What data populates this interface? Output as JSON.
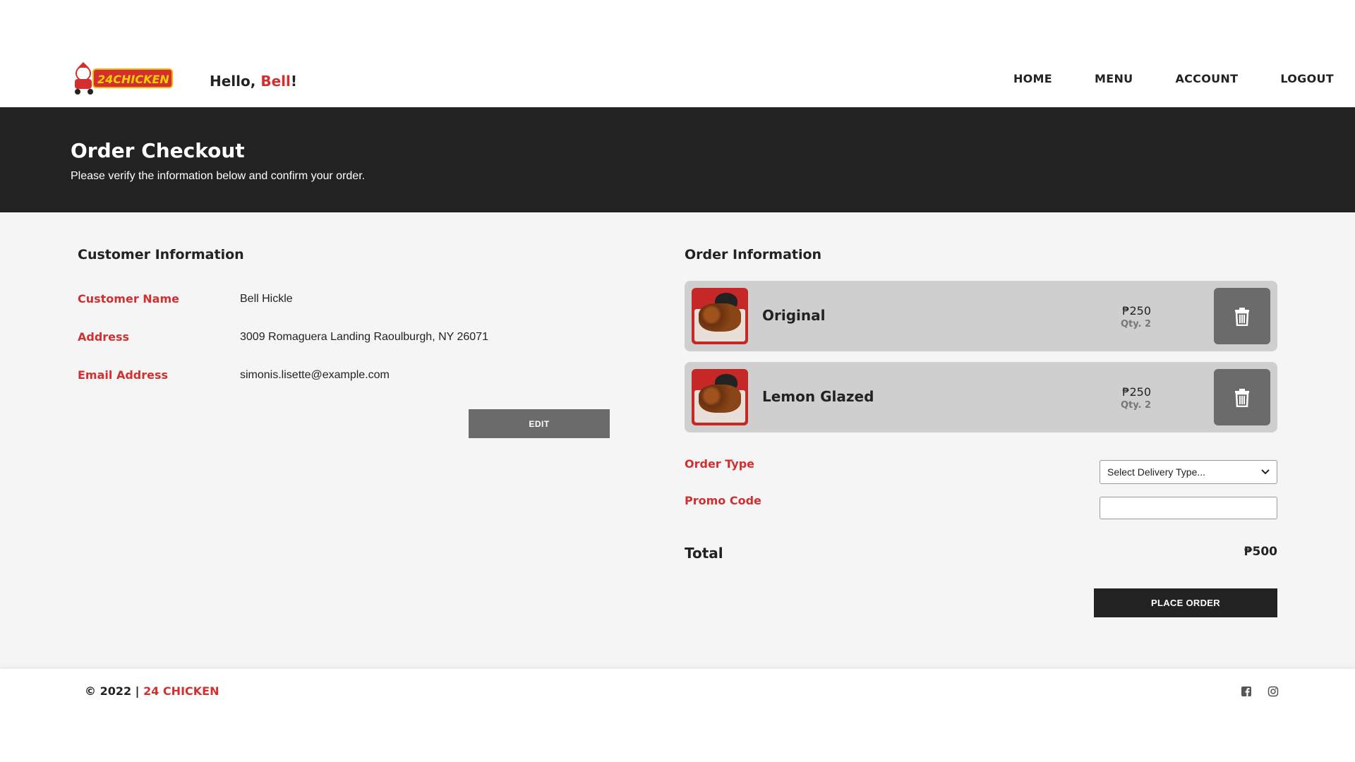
{
  "header": {
    "logo_text": "24CHICKEN",
    "greeting_prefix": "Hello, ",
    "greeting_name": "Bell",
    "greeting_suffix": "!",
    "nav": [
      "HOME",
      "MENU",
      "ACCOUNT",
      "LOGOUT"
    ]
  },
  "banner": {
    "title": "Order Checkout",
    "subtitle": "Please verify the information below and confirm your order."
  },
  "customer": {
    "title": "Customer Information",
    "rows": [
      {
        "label": "Customer Name",
        "value": "Bell Hickle"
      },
      {
        "label": "Address",
        "value": "3009 Romaguera Landing Raoulburgh, NY 26071"
      },
      {
        "label": "Email Address",
        "value": "simonis.lisette@example.com"
      }
    ],
    "edit_label": "EDIT"
  },
  "order": {
    "title": "Order Information",
    "items": [
      {
        "name": "Original",
        "price": "₱250",
        "qty": "Qty. 2"
      },
      {
        "name": "Lemon Glazed",
        "price": "₱250",
        "qty": "Qty. 2"
      }
    ],
    "order_type_label": "Order Type",
    "order_type_value": "Select Delivery Type...",
    "promo_label": "Promo Code",
    "promo_value": "",
    "total_label": "Total",
    "total_value": "₱500",
    "place_order_label": "PLACE ORDER"
  },
  "footer": {
    "copyright": "© 2022 | ",
    "brand": "24 CHICKEN",
    "social_icons": [
      "facebook-icon",
      "instagram-icon"
    ]
  },
  "colors": {
    "accent": "#d32f2f",
    "dark": "#222222",
    "button_gray": "#6b6b6b",
    "item_bg": "#cfcfcf"
  }
}
